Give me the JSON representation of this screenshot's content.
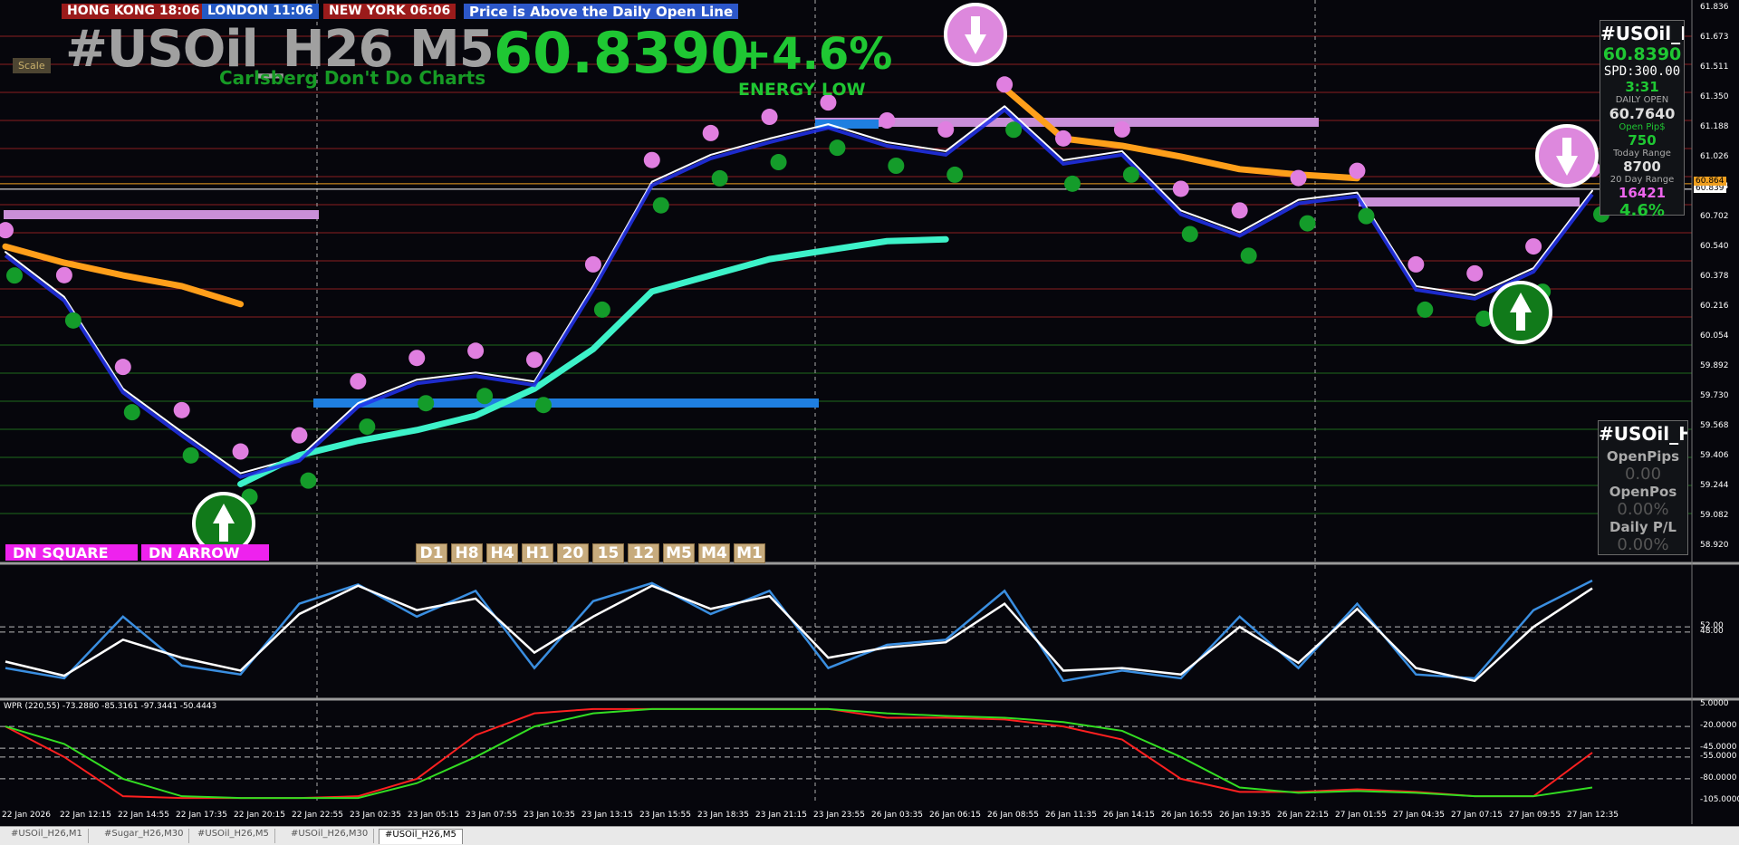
{
  "clocks": [
    {
      "label": "HONG KONG 18:06",
      "bg": "#9b1b1b"
    },
    {
      "label": "LONDON  11:06",
      "bg": "#2459c4"
    },
    {
      "label": "NEW YORK  06:06",
      "bg": "#9b1b1b"
    }
  ],
  "status_banner": "Price is Above the Daily Open Line",
  "header": {
    "symbol_title": "#USOil_H26 M5",
    "price": "60.8390",
    "percent": "+4.6%",
    "energy_label": "ENERGY LOW",
    "tagline": "Carlsberg Don't Do Charts",
    "scale_button": "Scale"
  },
  "buttons": {
    "dn_square": "DN SQUARE",
    "dn_arrow": "DN ARROW"
  },
  "timeframes": [
    "D1",
    "H8",
    "H4",
    "H1",
    "20",
    "15",
    "12",
    "M5",
    "M4",
    "M1"
  ],
  "info_panel": {
    "symbol": "#USOil_H",
    "price": "60.8390",
    "spread": "SPD:300.00",
    "timer": "3:31",
    "daily_open_label": "DAILY OPEN",
    "daily_open": "60.7640",
    "open_pips_label": "Open Pip$",
    "open_pips": "750",
    "today_range_label": "Today Range",
    "today_range": "8700",
    "day20_label": "20 Day Range",
    "day20_range": "16421",
    "percent": "4.6%"
  },
  "pl_panel": {
    "symbol": "#USOil_H",
    "open_pips_label": "OpenPips",
    "open_pips": "0.00",
    "open_pos_label": "OpenPos",
    "open_pos": "0.00%",
    "daily_pl_label": "Daily P/L",
    "daily_pl": "0.00%"
  },
  "price_axis": {
    "labels": [
      "61.836",
      "61.673",
      "61.511",
      "61.350",
      "61.188",
      "61.026",
      "60.864",
      "60.702",
      "60.540",
      "60.378",
      "60.216",
      "60.054",
      "59.892",
      "59.730",
      "59.568",
      "59.406",
      "59.244",
      "59.082",
      "58.920"
    ],
    "current_label": "60.839",
    "orange_label": "60.864"
  },
  "stoch_axis": [
    "52.00",
    "48.00"
  ],
  "wpr": {
    "label": "WPR (220,55) -73.2880 -85.3161 -97.3441 -50.4443",
    "axis": [
      "5.0000",
      "-20.0000",
      "-45.0000",
      "-55.0000",
      "-80.0000",
      "-105.0000"
    ]
  },
  "time_labels": [
    "22 Jan 2026",
    "22 Jan 12:15",
    "22 Jan 14:55",
    "22 Jan 17:35",
    "22 Jan 20:15",
    "22 Jan 22:55",
    "23 Jan 02:35",
    "23 Jan 05:15",
    "23 Jan 07:55",
    "23 Jan 10:35",
    "23 Jan 13:15",
    "23 Jan 15:55",
    "23 Jan 18:35",
    "23 Jan 21:15",
    "23 Jan 23:55",
    "26 Jan 03:35",
    "26 Jan 06:15",
    "26 Jan 08:55",
    "26 Jan 11:35",
    "26 Jan 14:15",
    "26 Jan 16:55",
    "26 Jan 19:35",
    "26 Jan 22:15",
    "27 Jan 01:55",
    "27 Jan 04:35",
    "27 Jan 07:15",
    "27 Jan 09:55",
    "27 Jan 12:35"
  ],
  "tabs": [
    "#USOil_H26,M1",
    "#Sugar_H26,M30",
    "#USOil_H26,M5",
    "#USOil_H26,M30",
    "#USOil_H26,M5"
  ],
  "active_tab": 4,
  "chart_data": {
    "type": "line",
    "title": "#USOil_H26 M5",
    "x": [
      "22 Jan 2026",
      "22 Jan 12:15",
      "22 Jan 14:55",
      "22 Jan 17:35",
      "22 Jan 20:15",
      "22 Jan 22:55",
      "23 Jan 02:35",
      "23 Jan 05:15",
      "23 Jan 07:55",
      "23 Jan 10:35",
      "23 Jan 13:15",
      "23 Jan 15:55",
      "23 Jan 18:35",
      "23 Jan 21:15",
      "23 Jan 23:55",
      "26 Jan 03:35",
      "26 Jan 06:15",
      "26 Jan 08:55",
      "26 Jan 11:35",
      "26 Jan 14:15",
      "26 Jan 16:55",
      "26 Jan 19:35",
      "26 Jan 22:15",
      "27 Jan 01:55",
      "27 Jan 04:35",
      "27 Jan 07:15",
      "27 Jan 09:55",
      "27 Jan 12:35"
    ],
    "ylim": [
      58.85,
      61.85
    ],
    "series": [
      {
        "values": [
          60.49,
          60.24,
          59.73,
          59.49,
          59.26,
          59.35,
          59.65,
          59.78,
          59.82,
          59.77,
          60.3,
          60.88,
          61.03,
          61.12,
          61.2,
          61.1,
          61.05,
          61.3,
          61.0,
          61.05,
          60.72,
          60.6,
          60.78,
          60.82,
          60.3,
          60.25,
          60.4,
          60.83
        ]
      },
      {
        "values": [
          60.52,
          60.43,
          60.36,
          60.3,
          60.2,
          null,
          null,
          null,
          null,
          null,
          null,
          null,
          null,
          null,
          null,
          null,
          null,
          61.4,
          61.12,
          61.08,
          61.02,
          60.95,
          60.92,
          60.9,
          null,
          null,
          null,
          60.84
        ]
      },
      {
        "values": [
          null,
          null,
          null,
          null,
          59.2,
          59.36,
          59.44,
          59.5,
          59.58,
          59.73,
          59.95,
          60.27,
          60.36,
          60.45,
          60.5,
          60.55,
          60.56,
          null,
          null,
          null,
          null,
          null,
          null,
          null,
          null,
          null,
          null,
          null
        ]
      }
    ],
    "stochastic": {
      "series": [
        {
          "values": [
            20,
            12,
            60,
            22,
            15,
            70,
            85,
            60,
            80,
            20,
            72,
            86,
            62,
            80,
            20,
            38,
            42,
            80,
            10,
            18,
            12,
            60,
            20,
            70,
            15,
            12,
            65,
            88
          ]
        },
        {
          "values": [
            25,
            14,
            42,
            28,
            18,
            62,
            84,
            65,
            74,
            32,
            60,
            84,
            66,
            76,
            28,
            36,
            40,
            70,
            18,
            20,
            15,
            52,
            24,
            66,
            20,
            10,
            52,
            82
          ]
        }
      ]
    },
    "wpr": {
      "ylim": [
        -105,
        5
      ],
      "series": [
        {
          "values": [
            -20,
            -55,
            -100,
            -102,
            -102,
            -102,
            -100,
            -80,
            -30,
            -5,
            0,
            0,
            0,
            0,
            0,
            -10,
            -10,
            -12,
            -20,
            -35,
            -80,
            -95,
            -95,
            -92,
            -95,
            -100,
            -100,
            -50
          ]
        },
        {
          "values": [
            -20,
            -40,
            -80,
            -100,
            -102,
            -102,
            -102,
            -85,
            -55,
            -20,
            -5,
            0,
            0,
            0,
            0,
            -5,
            -8,
            -10,
            -15,
            -25,
            -55,
            -90,
            -96,
            -94,
            -96,
            -100,
            -100,
            -90
          ]
        }
      ]
    }
  }
}
